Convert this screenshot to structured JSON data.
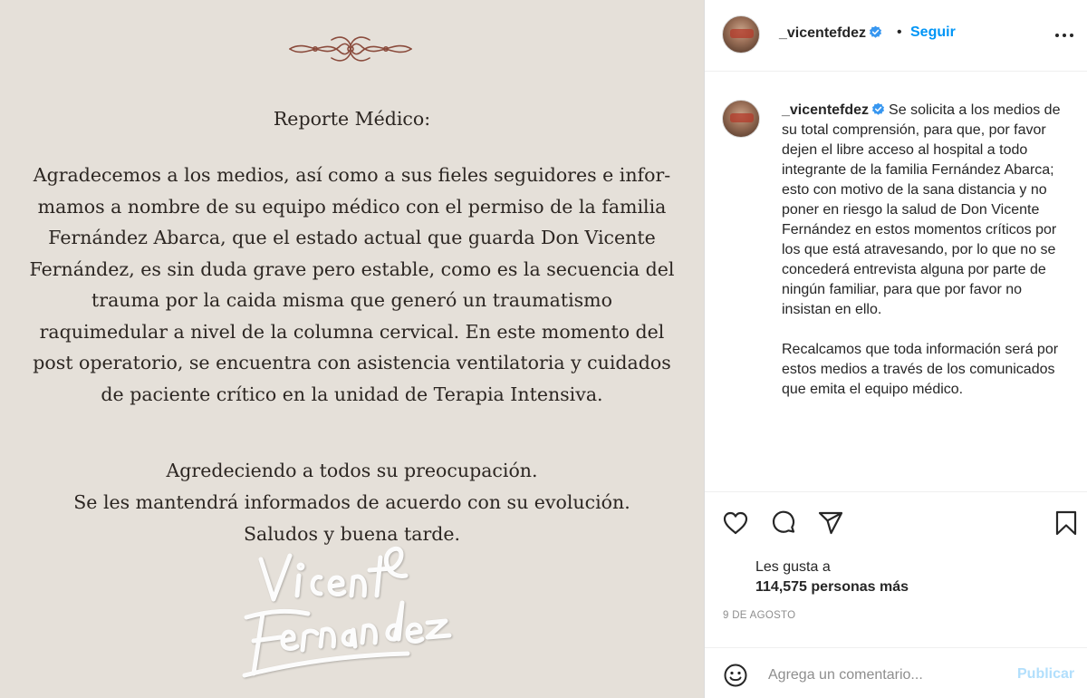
{
  "post_image": {
    "title": "Reporte Médico:",
    "body_lines": [
      "Agradecemos a los medios, así como a sus fieles seguidores e infor-",
      "mamos a nombre de su equipo médico con el permiso de la familia",
      "Fernández Abarca, que el estado actual que guarda Don Vicente",
      "Fernández, es sin duda grave pero estable, como es la secuencia del",
      "trauma por la caida misma que generó un traumatismo",
      "raquimedular a nivel de la columna cervical. En este momento del",
      "post operatorio, se encuentra con asistencia ventilatoria y cuidados",
      "de paciente crítico en la unidad de Terapia Intensiva."
    ],
    "closing_lines": [
      "Agredeciendo a todos su preocupación.",
      "Se les mantendrá informados de acuerdo con su evolución.",
      "Saludos y buena tarde."
    ],
    "signature_text": "Vicente Fernández",
    "background_color": "#e5e0d9",
    "ornament_color": "#8a4b3c"
  },
  "header": {
    "username": "_vicentefdez",
    "separator": "•",
    "follow_label": "Seguir"
  },
  "caption": {
    "username": "_vicentefdez",
    "paragraph_1": "Se solicita a los medios de su total comprensión, para que, por favor dejen el libre acceso al hospital a todo integrante de la familia Fernández Abarca; esto con motivo de la sana distancia y no poner en riesgo la salud de Don Vicente Fernández en estos momentos críticos por los que está atravesando, por lo que no se concederá entrevista alguna por parte de ningún familiar, para que por favor no insistan en ello.",
    "paragraph_2": "Recalcamos que toda información será por estos medios a través de los comunicados que emita el equipo médico."
  },
  "likes": {
    "label": "Les gusta a",
    "count": "114,575 personas más"
  },
  "date": "9 DE AGOSTO",
  "comment": {
    "placeholder": "Agrega un comentario...",
    "publish_label": "Publicar"
  },
  "colors": {
    "accent": "#0095f6",
    "verified": "#3897f0",
    "publish_disabled": "#b2dffc",
    "muted_text": "#8e8e8e"
  },
  "icons": [
    "verified-badge-icon",
    "more-options-icon",
    "heart-icon",
    "comment-icon",
    "share-icon",
    "bookmark-icon",
    "emoji-icon"
  ]
}
